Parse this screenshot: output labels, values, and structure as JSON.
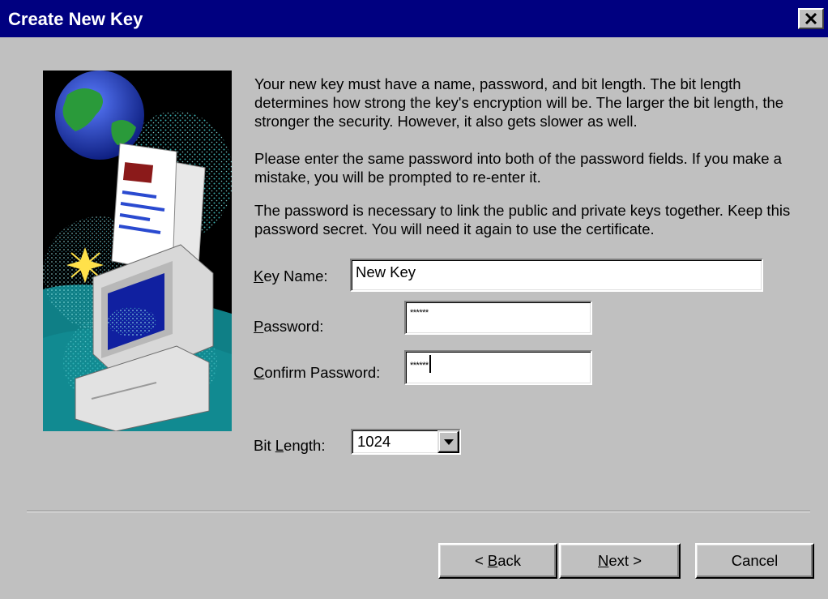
{
  "window": {
    "title": "Create New Key",
    "close_glyph": "×"
  },
  "intro": {
    "p1": "Your new key must have a name, password, and bit length. The bit length determines how strong the key's encryption will be. The larger the bit length, the stronger the security. However, it also gets slower as well.",
    "p2": "Please enter the same password into both of the password fields. If you make a mistake, you will be prompted to re-enter it.",
    "p3": "The password is necessary to link the public and private keys together. Keep this password secret. You will need it again to use the certificate."
  },
  "form": {
    "key_name": {
      "accel": "K",
      "rest": "ey Name:",
      "value": "New Key"
    },
    "password": {
      "accel": "P",
      "rest": "assword:",
      "value": "******"
    },
    "confirm_password": {
      "accel": "C",
      "rest": "onfirm Password:",
      "value": "******"
    },
    "bit_length": {
      "pre": "Bit ",
      "accel": "L",
      "rest": "ength:",
      "value": "1024"
    }
  },
  "buttons": {
    "back": {
      "lt": "< ",
      "accel": "B",
      "rest": "ack"
    },
    "next": {
      "accel": "N",
      "rest": "ext >"
    },
    "cancel": {
      "label": "Cancel"
    }
  },
  "icons": {
    "illustration": "globe-document-computer-icon",
    "close": "close-icon",
    "dropdown": "dropdown-arrow-icon"
  }
}
